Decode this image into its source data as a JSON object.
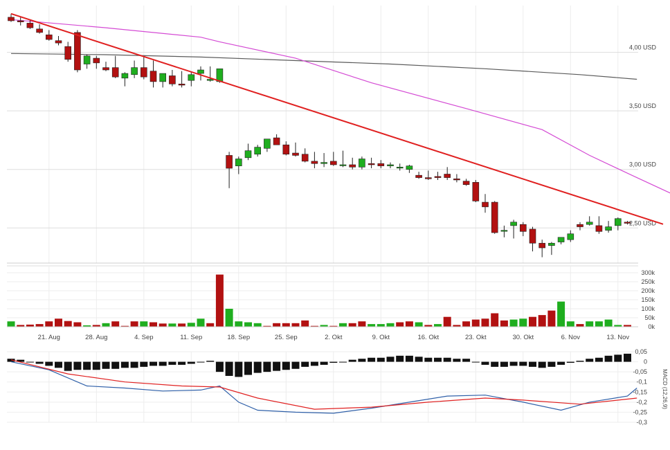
{
  "chart_data": [
    {
      "type": "candlestick",
      "name": "price",
      "unit_label": "USD",
      "y_ticks": [
        {
          "value": 4.0,
          "label": "4,00 USD"
        },
        {
          "value": 3.5,
          "label": "3,50 USD"
        },
        {
          "value": 3.0,
          "label": "3,00 USD"
        },
        {
          "value": 2.5,
          "label": "2,50 USD"
        }
      ],
      "ylim": [
        2.2,
        4.4
      ],
      "x_labels": [
        "21. Aug",
        "28. Aug",
        "4. Sep",
        "11. Sep",
        "18. Sep",
        "25. Sep",
        "2. Okt",
        "9. Okt",
        "16. Okt",
        "23. Okt",
        "30. Okt",
        "6. Nov",
        "13. Nov"
      ],
      "x_label_index": [
        4,
        9,
        14,
        19,
        24,
        29,
        34,
        39,
        44,
        49,
        54,
        59,
        64
      ],
      "candles": [
        [
          4.3,
          4.33,
          4.26,
          4.27
        ],
        [
          4.27,
          4.3,
          4.23,
          4.26
        ],
        [
          4.25,
          4.28,
          4.2,
          4.21
        ],
        [
          4.2,
          4.24,
          4.16,
          4.17
        ],
        [
          4.15,
          4.19,
          4.1,
          4.11
        ],
        [
          4.1,
          4.14,
          4.06,
          4.08
        ],
        [
          4.05,
          4.09,
          3.92,
          3.94
        ],
        [
          4.17,
          4.19,
          3.83,
          3.85
        ],
        [
          3.9,
          3.98,
          3.86,
          3.97
        ],
        [
          3.95,
          3.97,
          3.86,
          3.91
        ],
        [
          3.87,
          3.92,
          3.84,
          3.85
        ],
        [
          3.87,
          3.97,
          3.78,
          3.79
        ],
        [
          3.78,
          3.83,
          3.71,
          3.82
        ],
        [
          3.81,
          3.93,
          3.78,
          3.87
        ],
        [
          3.87,
          3.96,
          3.77,
          3.79
        ],
        [
          3.84,
          3.93,
          3.7,
          3.75
        ],
        [
          3.75,
          3.8,
          3.7,
          3.82
        ],
        [
          3.8,
          3.85,
          3.71,
          3.73
        ],
        [
          3.73,
          3.84,
          3.7,
          3.72
        ],
        [
          3.76,
          3.83,
          3.71,
          3.81
        ],
        [
          3.82,
          3.88,
          3.76,
          3.85
        ],
        [
          3.76,
          3.88,
          3.75,
          3.77
        ],
        [
          3.75,
          3.86,
          3.74,
          3.86
        ],
        [
          3.12,
          3.15,
          2.84,
          3.01
        ],
        [
          3.03,
          3.11,
          2.96,
          3.09
        ],
        [
          3.1,
          3.22,
          3.08,
          3.16
        ],
        [
          3.13,
          3.21,
          3.11,
          3.19
        ],
        [
          3.18,
          3.24,
          3.15,
          3.26
        ],
        [
          3.27,
          3.3,
          3.21,
          3.21
        ],
        [
          3.21,
          3.24,
          3.12,
          3.13
        ],
        [
          3.14,
          3.23,
          3.11,
          3.12
        ],
        [
          3.13,
          3.18,
          3.06,
          3.07
        ],
        [
          3.07,
          3.15,
          3.01,
          3.05
        ],
        [
          3.05,
          3.14,
          3.02,
          3.06
        ],
        [
          3.07,
          3.15,
          3.03,
          3.04
        ],
        [
          3.04,
          3.16,
          3.02,
          3.04
        ],
        [
          3.04,
          3.1,
          3.0,
          3.02
        ],
        [
          3.02,
          3.11,
          3.0,
          3.09
        ],
        [
          3.05,
          3.1,
          3.01,
          3.04
        ],
        [
          3.05,
          3.08,
          3.01,
          3.03
        ],
        [
          3.03,
          3.06,
          3.01,
          3.04
        ],
        [
          3.02,
          3.05,
          2.99,
          3.02
        ],
        [
          3.0,
          3.04,
          2.97,
          3.03
        ],
        [
          2.95,
          2.98,
          2.92,
          2.93
        ],
        [
          2.93,
          2.99,
          2.91,
          2.92
        ],
        [
          2.94,
          2.98,
          2.91,
          2.93
        ],
        [
          2.96,
          3.02,
          2.91,
          2.93
        ],
        [
          2.92,
          2.96,
          2.89,
          2.91
        ],
        [
          2.9,
          2.92,
          2.86,
          2.87
        ],
        [
          2.89,
          2.91,
          2.72,
          2.73
        ],
        [
          2.72,
          2.79,
          2.63,
          2.68
        ],
        [
          2.72,
          2.73,
          2.45,
          2.46
        ],
        [
          2.48,
          2.52,
          2.42,
          2.48
        ],
        [
          2.52,
          2.57,
          2.41,
          2.55
        ],
        [
          2.53,
          2.55,
          2.43,
          2.47
        ],
        [
          2.49,
          2.51,
          2.3,
          2.37
        ],
        [
          2.37,
          2.4,
          2.25,
          2.33
        ],
        [
          2.35,
          2.38,
          2.27,
          2.37
        ],
        [
          2.38,
          2.42,
          2.36,
          2.42
        ],
        [
          2.4,
          2.48,
          2.38,
          2.45
        ],
        [
          2.53,
          2.55,
          2.48,
          2.51
        ],
        [
          2.53,
          2.6,
          2.52,
          2.55
        ],
        [
          2.52,
          2.6,
          2.45,
          2.47
        ],
        [
          2.48,
          2.56,
          2.46,
          2.51
        ],
        [
          2.52,
          2.59,
          2.48,
          2.58
        ],
        [
          2.55,
          2.56,
          2.53,
          2.54
        ]
      ],
      "gaps": [
        {
          "afterIndex": 2,
          "reason": "chart start"
        }
      ],
      "sma200": [
        [
          0,
          3.99
        ],
        [
          10,
          3.98
        ],
        [
          20,
          3.96
        ],
        [
          30,
          3.93
        ],
        [
          40,
          3.9
        ],
        [
          50,
          3.86
        ],
        [
          60,
          3.81
        ],
        [
          66,
          3.77
        ]
      ],
      "sma50": [
        [
          0,
          4.28
        ],
        [
          10,
          4.21
        ],
        [
          20,
          4.13
        ],
        [
          22,
          4.09
        ],
        [
          30,
          3.95
        ],
        [
          38,
          3.74
        ],
        [
          48,
          3.52
        ],
        [
          56,
          3.34
        ],
        [
          61,
          3.12
        ],
        [
          66,
          2.93
        ],
        [
          70,
          2.78
        ]
      ],
      "trendline": [
        [
          0,
          4.33
        ],
        [
          70,
          2.5
        ]
      ],
      "colors": {
        "up": "#1fae1f",
        "down": "#b21111",
        "sma50": "#d44ad4",
        "sma200": "#5a5a5a",
        "trend": "#e02020",
        "grid": "#e3e3e3"
      }
    },
    {
      "type": "bar",
      "name": "volume",
      "y_ticks": [
        "300k",
        "250k",
        "200k",
        "150k",
        "100k",
        "50k",
        "0k"
      ],
      "ylim": [
        0,
        300000
      ],
      "values": [
        30000,
        10000,
        12000,
        15000,
        30000,
        45000,
        32000,
        25000,
        8000,
        10000,
        20000,
        30000,
        5000,
        30000,
        30000,
        25000,
        18000,
        18000,
        18000,
        22000,
        45000,
        20000,
        290000,
        100000,
        30000,
        25000,
        20000,
        5000,
        20000,
        20000,
        20000,
        35000,
        5000,
        10000,
        5000,
        20000,
        20000,
        30000,
        15000,
        15000,
        20000,
        25000,
        30000,
        25000,
        10000,
        15000,
        55000,
        10000,
        30000,
        40000,
        45000,
        75000,
        35000,
        40000,
        45000,
        55000,
        65000,
        90000,
        140000,
        30000,
        15000,
        30000,
        30000,
        40000,
        10000,
        10000
      ],
      "bar_up": [
        true,
        false,
        false,
        false,
        false,
        false,
        false,
        false,
        true,
        false,
        true,
        false,
        false,
        false,
        true,
        false,
        false,
        true,
        false,
        true,
        true,
        false,
        false,
        true,
        true,
        true,
        true,
        false,
        false,
        false,
        false,
        false,
        false,
        true,
        false,
        true,
        false,
        false,
        true,
        true,
        true,
        false,
        false,
        true,
        false,
        true,
        false,
        false,
        false,
        false,
        false,
        false,
        false,
        true,
        true,
        false,
        false,
        false,
        true,
        true,
        false,
        true,
        true,
        true,
        true,
        false
      ]
    },
    {
      "type": "macd",
      "name": "MACD (12,26,9)",
      "side_label": "MACD (12,26,9)",
      "y_ticks": [
        "0,05",
        "0",
        "-0,05",
        "-0,1",
        "-0,15",
        "-0,2",
        "-0,25",
        "-0,3"
      ],
      "ylim": [
        -0.3,
        0.05
      ],
      "histogram": [
        0.015,
        0.01,
        0.0,
        -0.01,
        -0.02,
        -0.03,
        -0.045,
        -0.04,
        -0.04,
        -0.04,
        -0.035,
        -0.035,
        -0.03,
        -0.03,
        -0.025,
        -0.02,
        -0.02,
        -0.015,
        -0.015,
        -0.01,
        0.0,
        0.005,
        -0.05,
        -0.07,
        -0.075,
        -0.065,
        -0.055,
        -0.05,
        -0.045,
        -0.04,
        -0.035,
        -0.025,
        -0.02,
        -0.015,
        -0.005,
        -0.0,
        0.01,
        0.015,
        0.02,
        0.02,
        0.025,
        0.03,
        0.03,
        0.025,
        0.02,
        0.02,
        0.02,
        0.015,
        0.015,
        0.0,
        -0.015,
        -0.025,
        -0.025,
        -0.02,
        -0.02,
        -0.025,
        -0.03,
        -0.025,
        -0.015,
        -0.005,
        0.005,
        0.015,
        0.02,
        0.03,
        0.035,
        0.04
      ],
      "macd_line": [
        [
          0,
          0.0
        ],
        [
          4,
          -0.04
        ],
        [
          8,
          -0.12
        ],
        [
          12,
          -0.13
        ],
        [
          16,
          -0.145
        ],
        [
          20,
          -0.14
        ],
        [
          22,
          -0.12
        ],
        [
          24,
          -0.2
        ],
        [
          26,
          -0.24
        ],
        [
          30,
          -0.25
        ],
        [
          34,
          -0.255
        ],
        [
          38,
          -0.23
        ],
        [
          42,
          -0.2
        ],
        [
          46,
          -0.17
        ],
        [
          50,
          -0.165
        ],
        [
          54,
          -0.2
        ],
        [
          58,
          -0.24
        ],
        [
          61,
          -0.2
        ],
        [
          65,
          -0.17
        ],
        [
          66,
          -0.13
        ]
      ],
      "signal_line": [
        [
          0,
          0.01
        ],
        [
          6,
          -0.06
        ],
        [
          12,
          -0.1
        ],
        [
          18,
          -0.12
        ],
        [
          22,
          -0.125
        ],
        [
          26,
          -0.18
        ],
        [
          32,
          -0.235
        ],
        [
          38,
          -0.225
        ],
        [
          44,
          -0.2
        ],
        [
          50,
          -0.18
        ],
        [
          54,
          -0.19
        ],
        [
          60,
          -0.21
        ],
        [
          66,
          -0.18
        ]
      ],
      "colors": {
        "hist": "#111111",
        "macd": "#2e5fa8",
        "signal": "#e02020"
      }
    }
  ]
}
